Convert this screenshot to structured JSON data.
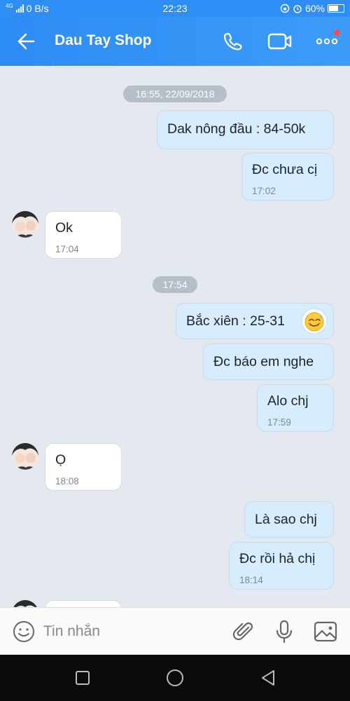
{
  "status_bar": {
    "network_type": "4G",
    "data_speed": "0 B/s",
    "time": "22:23",
    "battery": "60%"
  },
  "header": {
    "title": "Dau Tay Shop",
    "icons": [
      "back-arrow-icon",
      "phone-icon",
      "video-camera-icon",
      "more-dots-icon"
    ]
  },
  "chat": {
    "separators": [
      "16:55, 22/09/2018",
      "17:54"
    ],
    "messages": [
      {
        "side": "me",
        "text": "Dak nông đầu : 84-50k",
        "time": ""
      },
      {
        "side": "me",
        "text": "Đc chưa cị",
        "time": "17:02"
      },
      {
        "side": "them",
        "text": "Ok",
        "time": "17:04"
      },
      {
        "side": "me",
        "text": "Bắc xiên : 25-31",
        "time": "",
        "emoji": "smiling-sweat-emoji"
      },
      {
        "side": "me",
        "text": "Đc báo em nghe",
        "time": ""
      },
      {
        "side": "me",
        "text": "Alo chj",
        "time": "17:59"
      },
      {
        "side": "them",
        "text": "Ọ",
        "time": "18:08"
      },
      {
        "side": "me",
        "text": "Là sao chj",
        "time": ""
      },
      {
        "side": "me",
        "text": "Đc rồi hả chị",
        "time": "18:14"
      }
    ]
  },
  "input_bar": {
    "placeholder": "Tin nhắn",
    "icons": [
      "emoji-icon",
      "attachment-icon",
      "microphone-icon",
      "image-icon"
    ]
  },
  "colors": {
    "header": "#2f8ef5",
    "outgoing_bubble": "#d7ecfd",
    "incoming_bubble": "#ffffff",
    "chat_background": "#e4e9ef"
  }
}
